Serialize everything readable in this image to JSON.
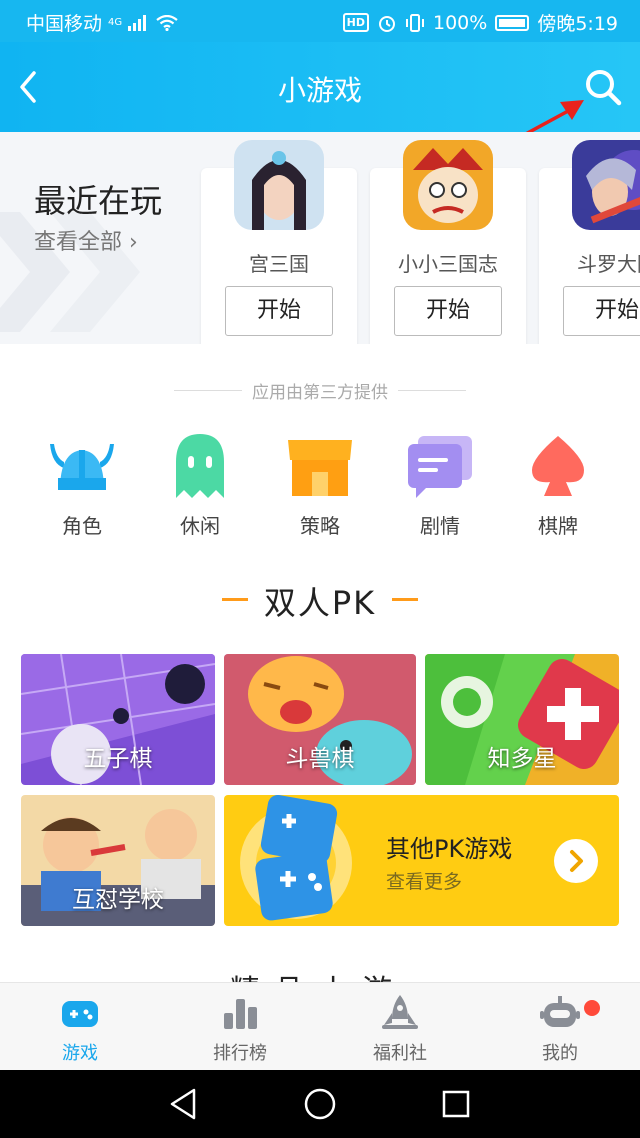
{
  "status_bar": {
    "carrier": "中国移动",
    "network": "4G",
    "battery": "100%",
    "time": "傍晚5:19",
    "hd": "HD"
  },
  "header": {
    "title": "小游戏"
  },
  "recent": {
    "title": "最近在玩",
    "view_all": "查看全部",
    "games": [
      {
        "name": "宫三国",
        "button": "开始"
      },
      {
        "name": "小小三国志",
        "button": "开始"
      },
      {
        "name": "斗罗大陆",
        "button": "开始"
      }
    ]
  },
  "provider_note": "应用由第三方提供",
  "categories": [
    {
      "label": "角色",
      "icon": "viking-helmet-icon"
    },
    {
      "label": "休闲",
      "icon": "ghost-icon"
    },
    {
      "label": "策略",
      "icon": "shop-icon"
    },
    {
      "label": "剧情",
      "icon": "chat-bubble-icon"
    },
    {
      "label": "棋牌",
      "icon": "spade-icon"
    }
  ],
  "pk_section": {
    "title": "双人PK",
    "tiles": [
      {
        "label": "五子棋"
      },
      {
        "label": "斗兽棋"
      },
      {
        "label": "知多星"
      },
      {
        "label": "互怼学校"
      }
    ],
    "other": {
      "title": "其他PK游戏",
      "subtitle": "查看更多"
    }
  },
  "next_section_peek": "精品小游",
  "tabbar": [
    {
      "label": "游戏",
      "icon": "gamepad-icon",
      "active": true
    },
    {
      "label": "排行榜",
      "icon": "bar-chart-icon",
      "active": false
    },
    {
      "label": "福利社",
      "icon": "rocket-icon",
      "active": false
    },
    {
      "label": "我的",
      "icon": "robot-icon",
      "active": false
    }
  ],
  "colors": {
    "brand": "#1aa7ec",
    "header": "#17b7f0",
    "accent": "#ff9b1a",
    "pk_other": "#ffcc12",
    "notify": "#ff4a3a"
  }
}
